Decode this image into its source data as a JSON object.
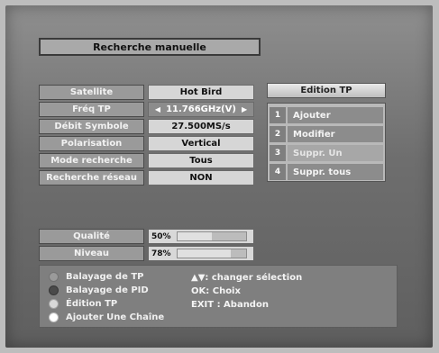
{
  "header": {
    "title": "Recherche manuelle"
  },
  "fields": [
    {
      "label": "Satellite",
      "value": "Hot Bird",
      "state": "normal"
    },
    {
      "label": "Fréq TP",
      "value": "11.766GHz(V)",
      "state": "active"
    },
    {
      "label": "Débit Symbole",
      "value": "27.500MS/s",
      "state": "normal"
    },
    {
      "label": "Polarisation",
      "value": "Vertical",
      "state": "normal"
    },
    {
      "label": "Mode recherche",
      "value": "Tous",
      "state": "normal"
    },
    {
      "label": "Recherche réseau",
      "value": "NON",
      "state": "normal"
    }
  ],
  "edit_tp": {
    "title": "Edition TP",
    "items": [
      {
        "num": "1",
        "label": "Ajouter"
      },
      {
        "num": "2",
        "label": "Modifier"
      },
      {
        "num": "3",
        "label": "Suppr. Un"
      },
      {
        "num": "4",
        "label": "Suppr. tous"
      }
    ]
  },
  "signal": {
    "quality_label": "Qualité",
    "quality_pct": "50%",
    "quality_value": 50,
    "level_label": "Niveau",
    "level_pct": "78%",
    "level_value": 78
  },
  "legend": [
    {
      "label": "Balayage de TP",
      "color": "#9a9a9a"
    },
    {
      "label": "Balayage de PID",
      "color": "#4a4a4a"
    },
    {
      "label": "Édition TP",
      "color": "#d8d8d8"
    },
    {
      "label": "Ajouter Une Chaîne",
      "color": "#ffffff"
    }
  ],
  "help": {
    "line1": "▲▼: changer sélection",
    "line2": "OK: Choix",
    "line3": "EXIT : Abandon"
  },
  "arrows": {
    "left": "◀",
    "right": "▶"
  }
}
